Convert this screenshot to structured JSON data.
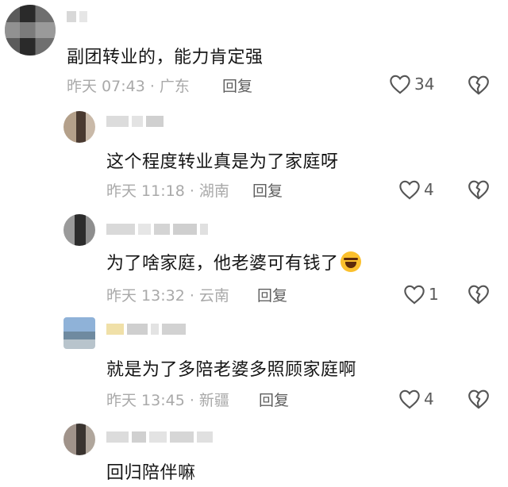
{
  "comments": [
    {
      "text": "副团转业的，能力肯定强",
      "meta": "昨天 07:43 · 广东",
      "reply": "回复",
      "likes": "34"
    },
    {
      "text": "这个程度转业真是为了家庭呀",
      "meta": "昨天 11:18 · 湖南",
      "reply": "回复",
      "likes": "4"
    },
    {
      "text": "为了啥家庭，他老婆可有钱了",
      "emoji": "laughing-crying-emoji",
      "meta": "昨天 13:32 · 云南",
      "reply": "回复",
      "likes": "1"
    },
    {
      "text": "就是为了多陪老婆多照顾家庭啊",
      "meta": "昨天 13:45 · 新疆",
      "reply": "回复",
      "likes": "4"
    },
    {
      "text": "回归陪伴嘛"
    }
  ],
  "icons": {
    "like": "heart-outline-icon",
    "dislike": "broken-heart-icon"
  },
  "colors": {
    "text": "#161616",
    "meta": "#a9a9a9",
    "reply": "#5f5f5f",
    "count": "#5a5a5a"
  }
}
